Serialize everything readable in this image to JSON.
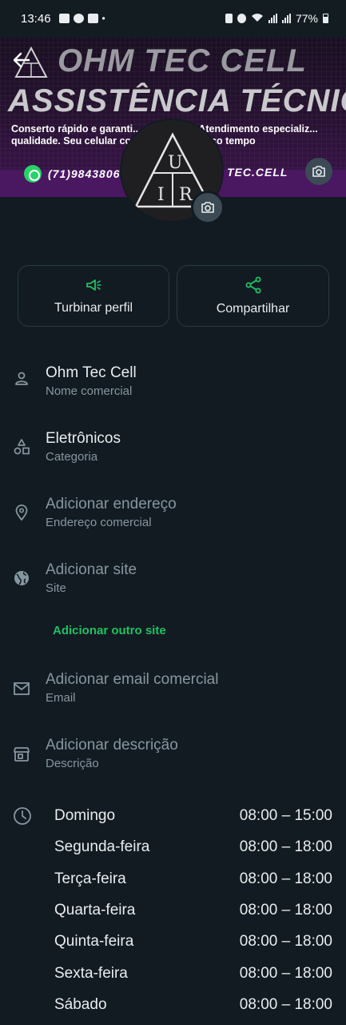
{
  "status_bar": {
    "time": "13:46",
    "battery": "77%",
    "dot": "•"
  },
  "cover": {
    "title_line1": "OHM TEC CELL",
    "title_line2": "ASSISTÊNCIA TÉCNICA",
    "tagline": "Conserto rápido e garanti... as marcas! Atendimento especializ... qualidade. Seu celular como novo em pouco tempo",
    "phone": "(71)9843806",
    "handle": "TEC.CELL",
    "logo_letters": [
      "U",
      "I",
      "R"
    ]
  },
  "actions": {
    "boost_label": "Turbinar perfil",
    "share_label": "Compartilhar"
  },
  "fields": {
    "business_name": {
      "value": "Ohm Tec Cell",
      "label": "Nome comercial"
    },
    "category": {
      "value": "Eletrônicos",
      "label": "Categoria"
    },
    "address": {
      "value": "Adicionar endereço",
      "label": "Endereço comercial"
    },
    "site": {
      "value": "Adicionar site",
      "label": "Site"
    },
    "add_other_site": "Adicionar outro site",
    "email": {
      "value": "Adicionar email comercial",
      "label": "Email"
    },
    "description": {
      "value": "Adicionar descrição",
      "label": "Descrição"
    }
  },
  "hours": [
    {
      "day": "Domingo",
      "time": "08:00 – 15:00"
    },
    {
      "day": "Segunda-feira",
      "time": "08:00 – 18:00"
    },
    {
      "day": "Terça-feira",
      "time": "08:00 – 18:00"
    },
    {
      "day": "Quarta-feira",
      "time": "08:00 – 18:00"
    },
    {
      "day": "Quinta-feira",
      "time": "08:00 – 18:00"
    },
    {
      "day": "Sexta-feira",
      "time": "08:00 – 18:00"
    },
    {
      "day": "Sábado",
      "time": "08:00 – 18:00"
    }
  ],
  "colors": {
    "background": "#121b22",
    "accent_green": "#21c063",
    "muted_text": "#8696a0",
    "cover_purple": "#4a1761"
  }
}
